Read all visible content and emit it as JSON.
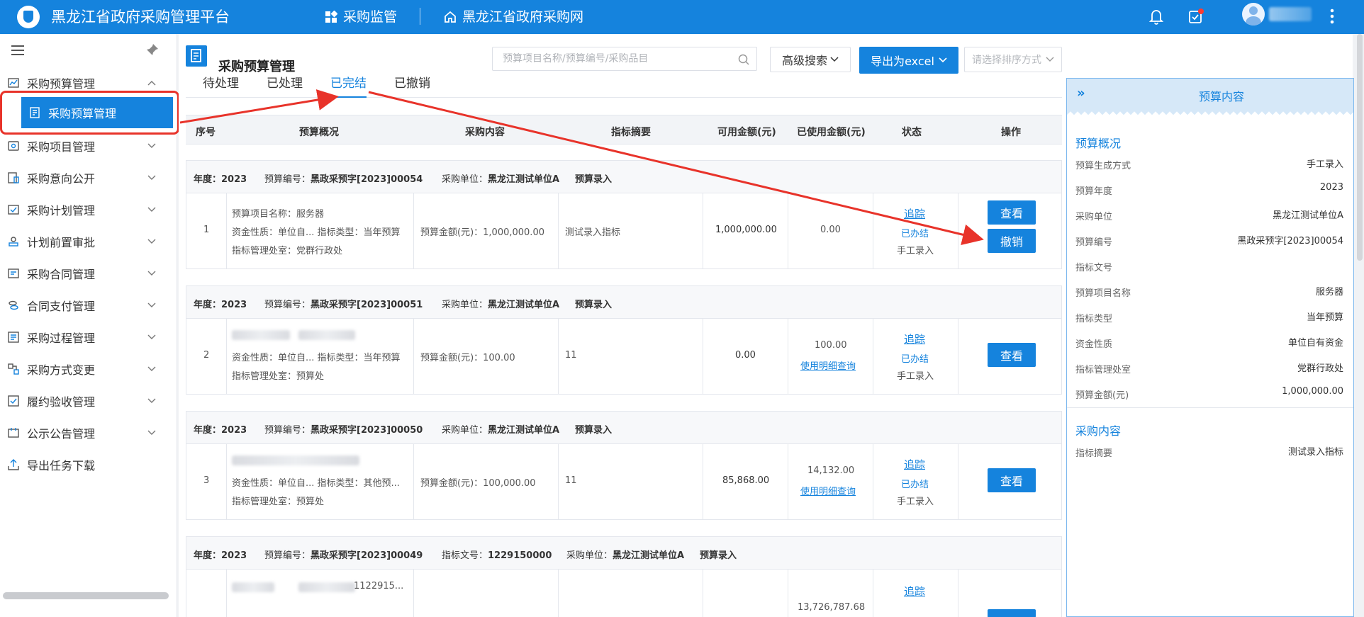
{
  "header": {
    "app_title": "黑龙江省政府采购管理平台",
    "nav_supervision": "采购监管",
    "nav_website": "黑龙江省政府采购网"
  },
  "sidebar": {
    "items": [
      {
        "label": "采购预算管理",
        "icon": "budget-icon"
      },
      {
        "label": "采购项目管理",
        "icon": "project-icon"
      },
      {
        "label": "采购意向公开",
        "icon": "intent-icon"
      },
      {
        "label": "采购计划管理",
        "icon": "plan-icon"
      },
      {
        "label": "计划前置审批",
        "icon": "approval-icon"
      },
      {
        "label": "采购合同管理",
        "icon": "contract-icon"
      },
      {
        "label": "合同支付管理",
        "icon": "payment-icon"
      },
      {
        "label": "采购过程管理",
        "icon": "process-icon"
      },
      {
        "label": "采购方式变更",
        "icon": "method-change-icon"
      },
      {
        "label": "履约验收管理",
        "icon": "acceptance-icon"
      },
      {
        "label": "公示公告管理",
        "icon": "announcement-icon"
      },
      {
        "label": "导出任务下载",
        "icon": "download-icon"
      }
    ],
    "active_sub": "采购预算管理"
  },
  "page": {
    "title": "采购预算管理",
    "search_placeholder": "预算项目名称/预算编号/采购品目",
    "advanced_search": "高级搜索",
    "export_label": "导出为excel",
    "sort_placeholder": "请选择排序方式"
  },
  "tabs": [
    "待处理",
    "已处理",
    "已完结",
    "已撤销"
  ],
  "active_tab": "已完结",
  "table_headers": [
    "序号",
    "预算概况",
    "采购内容",
    "指标摘要",
    "可用金额(元)",
    "已使用金额(元)",
    "状态",
    "操作"
  ],
  "records": [
    {
      "year_label": "年度：",
      "year": "2023",
      "code_label": "预算编号：",
      "code": "黑政采预字[2023]00054",
      "unit_label": "采购单位：",
      "unit": "黑龙江测试单位A",
      "entry": "预算录入",
      "index": "1",
      "line1": "预算项目名称：服务器",
      "line2": "资金性质：单位自...  指标类型：当年预算",
      "line3": "指标管理处室：党群行政处",
      "content": "预算金额(元)：1,000,000.00",
      "summary": "测试录入指标",
      "available": "1,000,000.00",
      "used": "0.00",
      "used_link": "",
      "track": "追踪",
      "status": "已办结",
      "source": "手工录入",
      "btn_view": "查看",
      "btn_revoke": "撤销"
    },
    {
      "year_label": "年度：",
      "year": "2023",
      "code_label": "预算编号：",
      "code": "黑政采预字[2023]00051",
      "unit_label": "采购单位：",
      "unit": "黑龙江测试单位A",
      "entry": "预算录入",
      "index": "2",
      "line1": "",
      "line2": "资金性质：单位自...  指标类型：当年预算",
      "line3": "指标管理处室：预算处",
      "content": "预算金额(元)：100.00",
      "summary": "11",
      "available": "0.00",
      "used": "100.00",
      "used_link": "使用明细查询",
      "track": "追踪",
      "status": "已办结",
      "source": "手工录入",
      "btn_view": "查看",
      "btn_revoke": ""
    },
    {
      "year_label": "年度：",
      "year": "2023",
      "code_label": "预算编号：",
      "code": "黑政采预字[2023]00050",
      "unit_label": "采购单位：",
      "unit": "黑龙江测试单位A",
      "entry": "预算录入",
      "index": "3",
      "line1": "",
      "line2": "资金性质：单位自...  指标类型：其他预...",
      "line3": "指标管理处室：预算处",
      "content": "预算金额(元)：100,000.00",
      "summary": "11",
      "available": "85,868.00",
      "used": "14,132.00",
      "used_link": "使用明细查询",
      "track": "追踪",
      "status": "已办结",
      "source": "手工录入",
      "btn_view": "查看",
      "btn_revoke": ""
    },
    {
      "year_label": "年度：",
      "year": "2023",
      "code_label": "预算编号：",
      "code": "黑政采预字[2023]00049",
      "doc_label": "指标文号：",
      "doc": "1229150000",
      "unit_label": "采购单位：",
      "unit": "黑龙江测试单位A",
      "entry": "预算录入",
      "partial_code": "1122915...",
      "used": "13,726,787.68",
      "track": "追踪"
    }
  ],
  "detail": {
    "title": "预算内容",
    "section1": "预算概况",
    "fields": [
      {
        "k": "预算生成方式",
        "v": "手工录入"
      },
      {
        "k": "预算年度",
        "v": "2023"
      },
      {
        "k": "采购单位",
        "v": "黑龙江测试单位A"
      },
      {
        "k": "预算编号",
        "v": "黑政采预字[2023]00054"
      },
      {
        "k": "指标文号",
        "v": ""
      },
      {
        "k": "预算项目名称",
        "v": "服务器"
      },
      {
        "k": "指标类型",
        "v": "当年预算"
      },
      {
        "k": "资金性质",
        "v": "单位自有资金"
      },
      {
        "k": "指标管理处室",
        "v": "党群行政处"
      },
      {
        "k": "预算金额(元)",
        "v": "1,000,000.00"
      }
    ],
    "section2": "采购内容",
    "fields2": [
      {
        "k": "指标摘要",
        "v": "测试录入指标"
      }
    ]
  },
  "colors": {
    "primary": "#1583dd",
    "annotation": "#e8332a"
  }
}
